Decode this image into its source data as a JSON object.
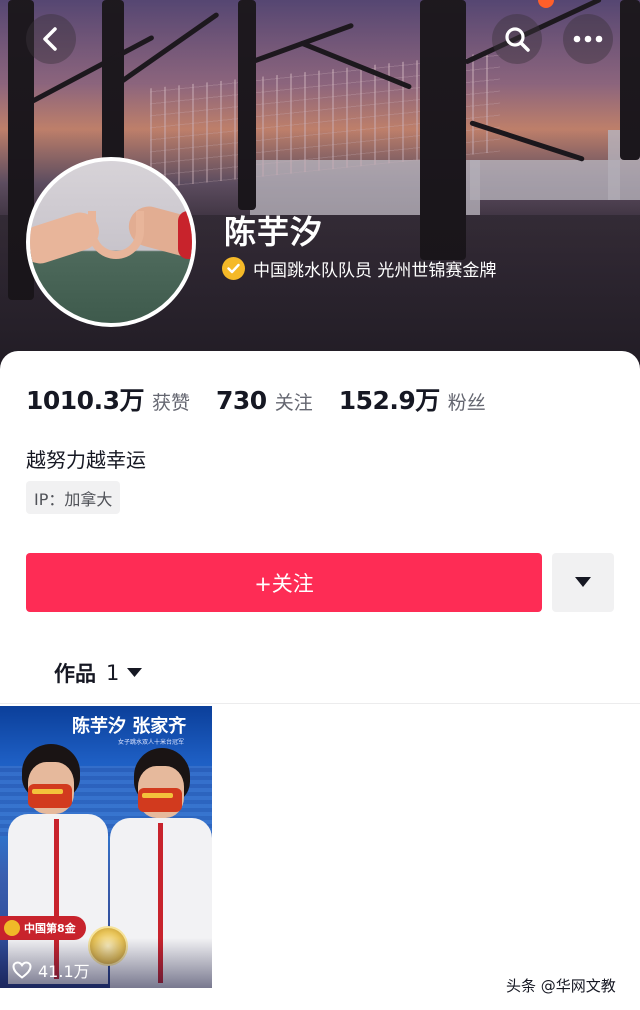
{
  "profile": {
    "name": "陈芋汐",
    "verified_text": "中国跳水队队员 光州世锦赛金牌"
  },
  "stats": [
    {
      "value": "1010.3万",
      "label": "获赞"
    },
    {
      "value": "730",
      "label": "关注"
    },
    {
      "value": "152.9万",
      "label": "粉丝"
    }
  ],
  "bio": "越努力越幸运",
  "ip_tag": "IP：加拿大",
  "follow_button": "+关注",
  "works_tab": {
    "label": "作品",
    "count": "1"
  },
  "videos": [
    {
      "title_text": "陈芋汐 张家齐",
      "subtitle_text": "女子跳水双人十米台冠军",
      "medal_tag": "中国第8金",
      "likes": "41.1万"
    }
  ],
  "watermark": "头条 @华网文教",
  "colors": {
    "accent": "#fe2c55",
    "verified": "#f5b928"
  },
  "icons": [
    "back-icon",
    "search-icon",
    "more-icon",
    "verified-icon",
    "dropdown-icon",
    "heart-icon"
  ]
}
